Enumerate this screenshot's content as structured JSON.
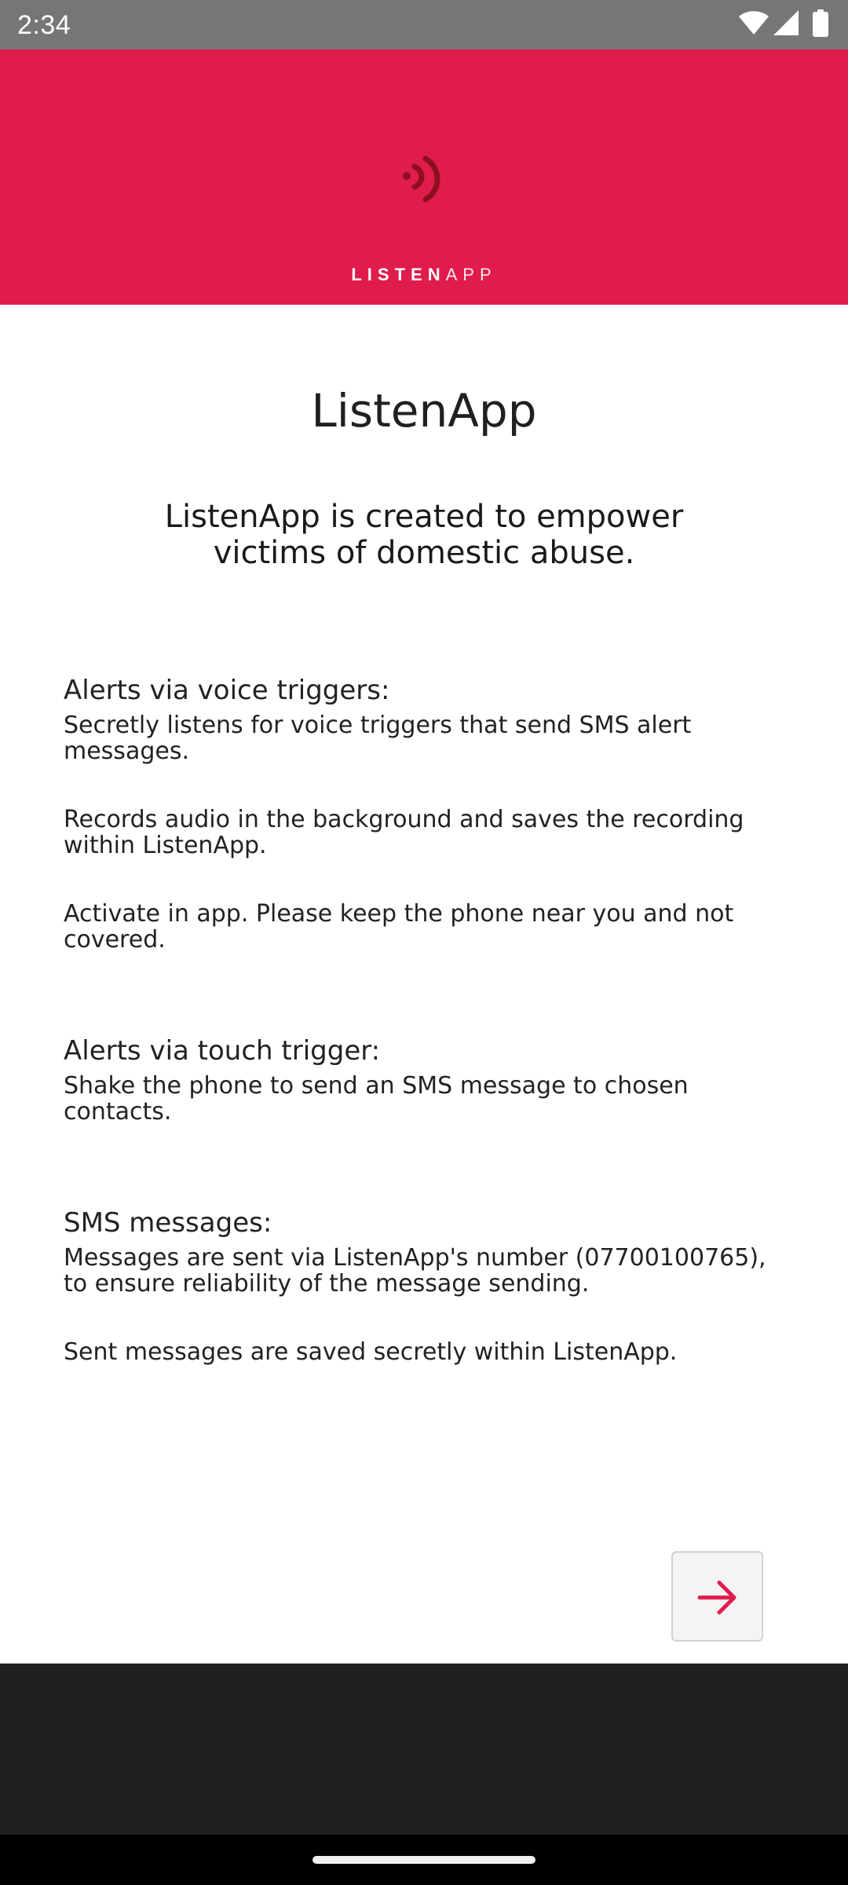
{
  "status_bar": {
    "time": "2:34",
    "icons": [
      "wifi-icon",
      "signal-icon",
      "battery-icon"
    ]
  },
  "header": {
    "background_color": "#e01c4c",
    "logo_text_bold": "LISTEN",
    "logo_text_light": "APP",
    "logo_icon": "listen-logo-icon"
  },
  "main": {
    "title": "ListenApp",
    "tagline": "ListenApp is created to empower victims of domestic abuse.",
    "sections": [
      {
        "heading": "Alerts via voice triggers:",
        "paragraphs": [
          "Secretly listens for voice triggers that send SMS alert messages.",
          "Records audio in the background and saves the recording within ListenApp.",
          "Activate in app. Please keep the phone near you and not covered."
        ]
      },
      {
        "heading": "Alerts via touch trigger:",
        "paragraphs": [
          "Shake the phone to send an SMS message to chosen contacts."
        ]
      },
      {
        "heading": "SMS messages:",
        "paragraphs": [
          "Messages are sent via ListenApp's number (07700100765), to ensure reliability of the message sending.",
          "Sent messages are saved secretly within ListenApp."
        ]
      }
    ]
  },
  "next_button": {
    "icon": "arrow-right-icon",
    "accent_color": "#e01c4c"
  }
}
